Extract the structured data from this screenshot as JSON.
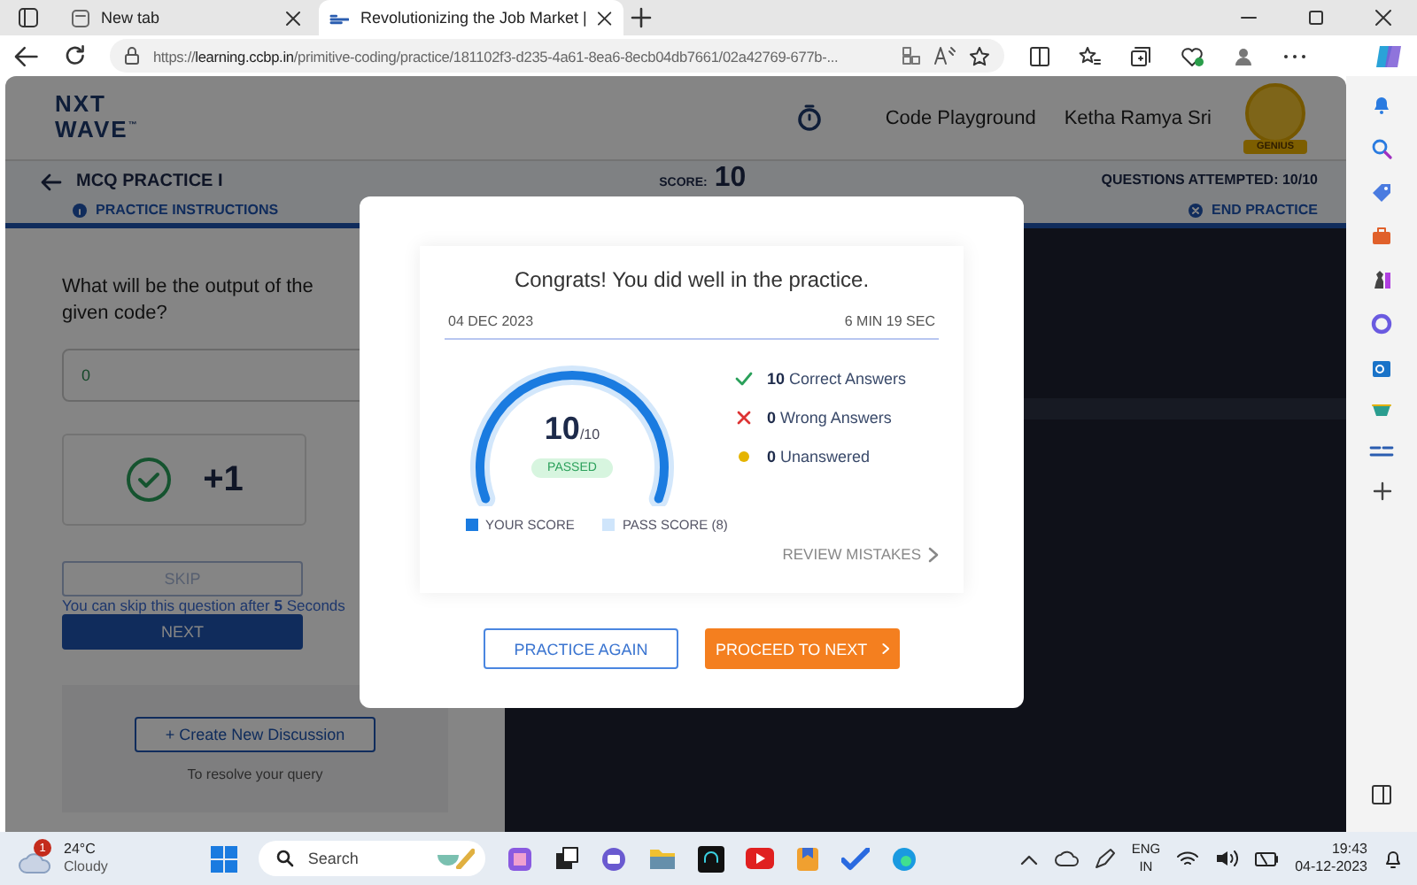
{
  "browser": {
    "tabs": [
      {
        "title": "New tab",
        "selected": false
      },
      {
        "title": "Revolutionizing the Job Market |",
        "selected": true
      }
    ],
    "url": "https://**learning.ccbp.in**/primitive-coding/practice/181102f3-d235-4a61-8ea6-8ecb04db7661/02a42769-677b-..."
  },
  "header": {
    "logo_top": "NXT",
    "logo_bottom": "WAVE",
    "logo_suffix": "™",
    "link": "Code Playground",
    "user_name": "Ketha Ramya Sri",
    "avatar_badge": "GENIUS"
  },
  "practice_bar": {
    "title": "MCQ PRACTICE I",
    "instructions": "PRACTICE INSTRUCTIONS",
    "score_label": "SCORE:",
    "score": "10",
    "attempted": "QUESTIONS ATTEMPTED: 10/10",
    "end": "END PRACTICE"
  },
  "question": {
    "text": "What will be the output of the given code?",
    "answer": "0",
    "points": "+1",
    "skip": "SKIP",
    "skip_disabled": true,
    "skip_note": "You can skip this question after **5** Seconds",
    "next": "NEXT",
    "discussion_button": "+ Create New Discussion",
    "discussion_note": "To resolve your query"
  },
  "result": {
    "title": "Congrats! You did well in the practice.",
    "date": "04 DEC 2023",
    "duration": "6 MIN 19 SEC",
    "gauge": {
      "level": 1,
      "score": "10",
      "total": "/10",
      "status": "PASSED"
    },
    "stats": [
      {
        "kind": "correct",
        "count": "10",
        "label": "Correct Answers"
      },
      {
        "kind": "wrong",
        "count": "0",
        "label": "Wrong Answers"
      },
      {
        "kind": "unanswered",
        "count": "0",
        "label": "Unanswered"
      }
    ],
    "legend": [
      {
        "kind": "score",
        "label": "YOUR SCORE"
      },
      {
        "kind": "pass",
        "label": "PASS SCORE (8)"
      }
    ],
    "review": "REVIEW MISTAKES",
    "buttons": [
      {
        "kind": "outline",
        "label": "PRACTICE AGAIN"
      },
      {
        "kind": "primary",
        "label": "PROCEED TO NEXT"
      }
    ]
  },
  "taskbar": {
    "temperature": "24°C",
    "condition": "Cloudy",
    "weather_badge": "1",
    "search_placeholder": "Search",
    "language": "ENG",
    "region": "IN",
    "time": "19:43",
    "date": "04-12-2023"
  }
}
